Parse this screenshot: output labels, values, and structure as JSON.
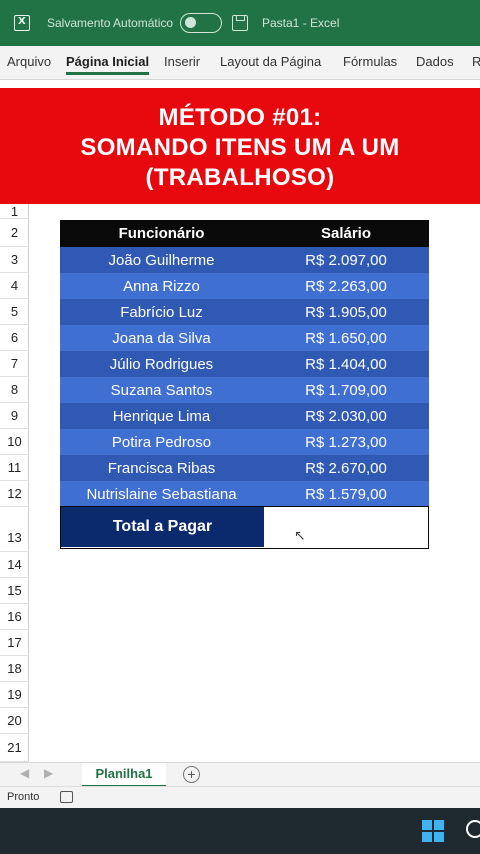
{
  "titlebar": {
    "autosave_label": "Salvamento Automático",
    "document": "Pasta1  -  Excel",
    "icons": [
      "excel-icon",
      "toggle-switch",
      "save-icon"
    ]
  },
  "ribbon": {
    "tabs": [
      "Arquivo",
      "Página Inicial",
      "Inserir",
      "Layout da Página",
      "Fórmulas",
      "Dados",
      "R"
    ]
  },
  "banner": {
    "line1": "MÉTODO #01:",
    "line2": "SOMANDO ITENS UM A UM",
    "line3": "(TRABALHOSO)",
    "color": "#e8090f"
  },
  "row_numbers": [
    "1",
    "2",
    "3",
    "4",
    "5",
    "6",
    "7",
    "8",
    "9",
    "10",
    "11",
    "12",
    "13",
    "14",
    "15",
    "16",
    "17",
    "18",
    "19",
    "20",
    "21"
  ],
  "table": {
    "headers": [
      "Funcionário",
      "Salário"
    ],
    "rows": [
      {
        "name": "João Guilherme",
        "salary": "R$ 2.097,00"
      },
      {
        "name": "Anna Rizzo",
        "salary": "R$ 2.263,00"
      },
      {
        "name": "Fabrício Luz",
        "salary": "R$ 1.905,00"
      },
      {
        "name": "Joana da Silva",
        "salary": "R$ 1.650,00"
      },
      {
        "name": "Júlio Rodrigues",
        "salary": "R$ 1.404,00"
      },
      {
        "name": "Suzana Santos",
        "salary": "R$ 1.709,00"
      },
      {
        "name": "Henrique Lima",
        "salary": "R$ 2.030,00"
      },
      {
        "name": "Potira Pedroso",
        "salary": "R$ 1.273,00"
      },
      {
        "name": "Francisca Ribas",
        "salary": "R$ 2.670,00"
      },
      {
        "name": "Nutrislaine Sebastiana",
        "salary": "R$ 1.579,00"
      }
    ],
    "total_label": "Total a Pagar",
    "total_value": "",
    "row_colors": [
      "#2f59b3",
      "#3f6fd0"
    ]
  },
  "sheets": {
    "active": "Planilha1",
    "add_label": "+"
  },
  "status": {
    "text": "Pronto"
  }
}
